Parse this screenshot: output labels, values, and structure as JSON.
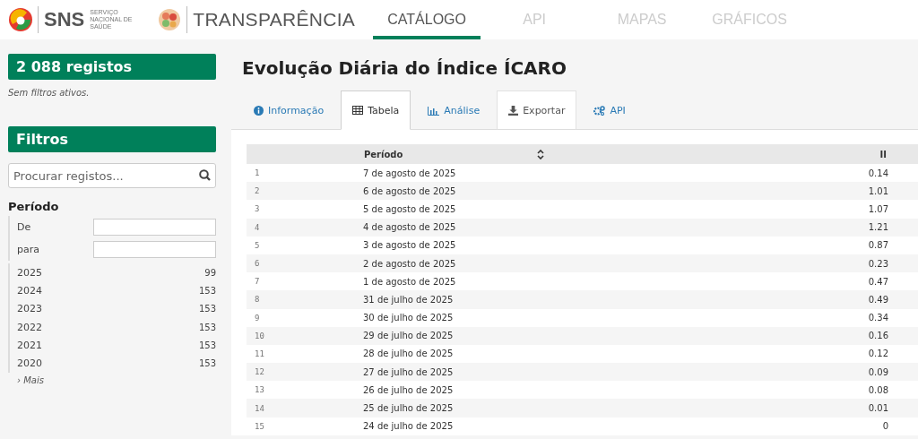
{
  "header": {
    "sns_logo": "SNS",
    "sns_subtitle": "SERVIÇO NACIONAL DE SAÚDE",
    "brand": "TRANSPARÊNCIA",
    "nav": [
      {
        "label": "CATÁLOGO",
        "selected": true
      },
      {
        "label": "API",
        "selected": false
      },
      {
        "label": "MAPAS",
        "selected": false
      },
      {
        "label": "GRÁFICOS",
        "selected": false
      }
    ]
  },
  "sidebar": {
    "count": "2 088 registos",
    "no_filters": "Sem filtros ativos.",
    "filters_title": "Filtros",
    "search": {
      "placeholder": "Procurar registos..."
    },
    "facet": {
      "title": "Período",
      "range": [
        {
          "label": "De"
        },
        {
          "label": "para"
        }
      ],
      "values": [
        {
          "label": "2025",
          "count": "99"
        },
        {
          "label": "2024",
          "count": "153"
        },
        {
          "label": "2023",
          "count": "153"
        },
        {
          "label": "2022",
          "count": "153"
        },
        {
          "label": "2021",
          "count": "153"
        },
        {
          "label": "2020",
          "count": "153"
        }
      ],
      "more": "› Mais"
    }
  },
  "title": "Evolução Diária do Índice ÍCARO",
  "tabs": [
    {
      "label": "Informação",
      "selected": false,
      "boxed": false
    },
    {
      "label": "Tabela",
      "selected": true,
      "boxed": true
    },
    {
      "label": "Análise",
      "selected": false,
      "boxed": false
    },
    {
      "label": "Exportar",
      "selected": false,
      "boxed": true
    },
    {
      "label": "API",
      "selected": false,
      "boxed": false
    }
  ],
  "table": {
    "columns": [
      "",
      "Período",
      "II"
    ],
    "rows": [
      [
        "1",
        "7 de agosto de 2025",
        "0.14"
      ],
      [
        "2",
        "6 de agosto de 2025",
        "1.01"
      ],
      [
        "3",
        "5 de agosto de 2025",
        "1.07"
      ],
      [
        "4",
        "4 de agosto de 2025",
        "1.21"
      ],
      [
        "5",
        "3 de agosto de 2025",
        "0.87"
      ],
      [
        "6",
        "2 de agosto de 2025",
        "0.23"
      ],
      [
        "7",
        "1 de agosto de 2025",
        "0.47"
      ],
      [
        "8",
        "31 de julho de 2025",
        "0.49"
      ],
      [
        "9",
        "30 de julho de 2025",
        "0.34"
      ],
      [
        "10",
        "29 de julho de 2025",
        "0.16"
      ],
      [
        "11",
        "28 de julho de 2025",
        "0.12"
      ],
      [
        "12",
        "27 de julho de 2025",
        "0.09"
      ],
      [
        "13",
        "26 de julho de 2025",
        "0.08"
      ],
      [
        "14",
        "25 de julho de 2025",
        "0.01"
      ],
      [
        "15",
        "24 de julho de 2025",
        "0"
      ]
    ]
  }
}
